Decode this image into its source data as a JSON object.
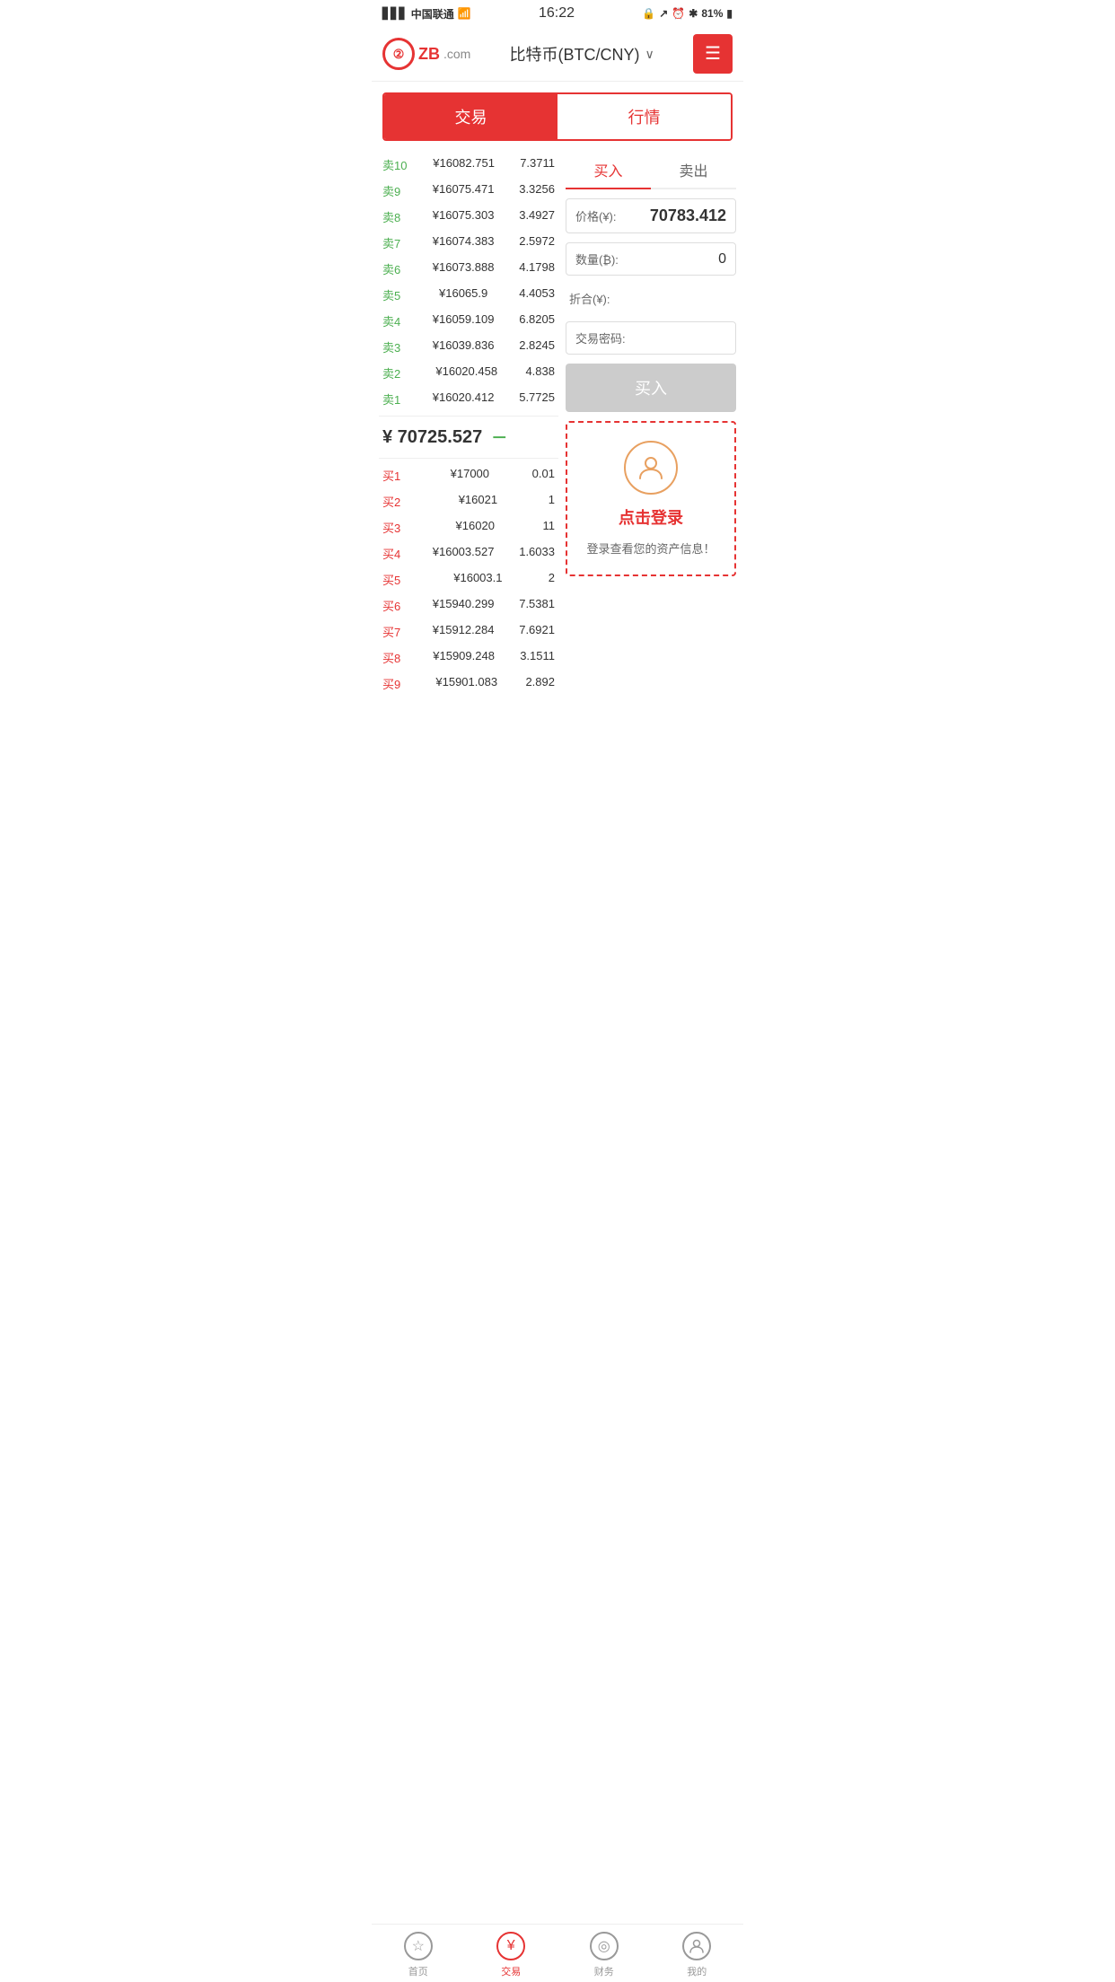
{
  "statusBar": {
    "carrier": "中国联通",
    "time": "16:22",
    "battery": "81%"
  },
  "header": {
    "logoText": "ZB",
    "logoDomain": ".com",
    "title": "比特币(BTC/CNY)",
    "menuLabel": "≡"
  },
  "tabs": [
    {
      "label": "交易",
      "active": true
    },
    {
      "label": "行情",
      "active": false
    }
  ],
  "orderBook": {
    "sellOrders": [
      {
        "label": "卖10",
        "price": "¥16082.751",
        "amount": "7.3711"
      },
      {
        "label": "卖9",
        "price": "¥16075.471",
        "amount": "3.3256"
      },
      {
        "label": "卖8",
        "price": "¥16075.303",
        "amount": "3.4927"
      },
      {
        "label": "卖7",
        "price": "¥16074.383",
        "amount": "2.5972"
      },
      {
        "label": "卖6",
        "price": "¥16073.888",
        "amount": "4.1798"
      },
      {
        "label": "卖5",
        "price": "¥16065.9",
        "amount": "4.4053"
      },
      {
        "label": "卖4",
        "price": "¥16059.109",
        "amount": "6.8205"
      },
      {
        "label": "卖3",
        "price": "¥16039.836",
        "amount": "2.8245"
      },
      {
        "label": "卖2",
        "price": "¥16020.458",
        "amount": "4.838"
      },
      {
        "label": "卖1",
        "price": "¥16020.412",
        "amount": "5.7725"
      }
    ],
    "midPrice": "¥ 70725.527",
    "midSign": "－",
    "buyOrders": [
      {
        "label": "买1",
        "price": "¥17000",
        "amount": "0.01"
      },
      {
        "label": "买2",
        "price": "¥16021",
        "amount": "1"
      },
      {
        "label": "买3",
        "price": "¥16020",
        "amount": "11"
      },
      {
        "label": "买4",
        "price": "¥16003.527",
        "amount": "1.6033"
      },
      {
        "label": "买5",
        "price": "¥16003.1",
        "amount": "2"
      },
      {
        "label": "买6",
        "price": "¥15940.299",
        "amount": "7.5381"
      },
      {
        "label": "买7",
        "price": "¥15912.284",
        "amount": "7.6921"
      },
      {
        "label": "买8",
        "price": "¥15909.248",
        "amount": "3.1511"
      },
      {
        "label": "买9",
        "price": "¥15901.083",
        "amount": "2.892"
      }
    ]
  },
  "tradePanel": {
    "buyTab": "买入",
    "sellTab": "卖出",
    "priceLabel": "价格(¥):",
    "priceValue": "70783.412",
    "quantityLabel": "数量(₿):",
    "quantityValue": "0",
    "totalLabel": "折合(¥):",
    "totalValue": "",
    "passwordLabel": "交易密码:",
    "buyBtnLabel": "买入",
    "loginAvatarIcon": "👤",
    "loginBtnLabel": "点击登录",
    "loginSubText": "登录查看您的资产信息！"
  },
  "bottomNav": [
    {
      "label": "首页",
      "icon": "☆",
      "active": false
    },
    {
      "label": "交易",
      "icon": "¥",
      "active": true
    },
    {
      "label": "财务",
      "icon": "◎",
      "active": false
    },
    {
      "label": "我的",
      "icon": "👤",
      "active": false
    }
  ]
}
